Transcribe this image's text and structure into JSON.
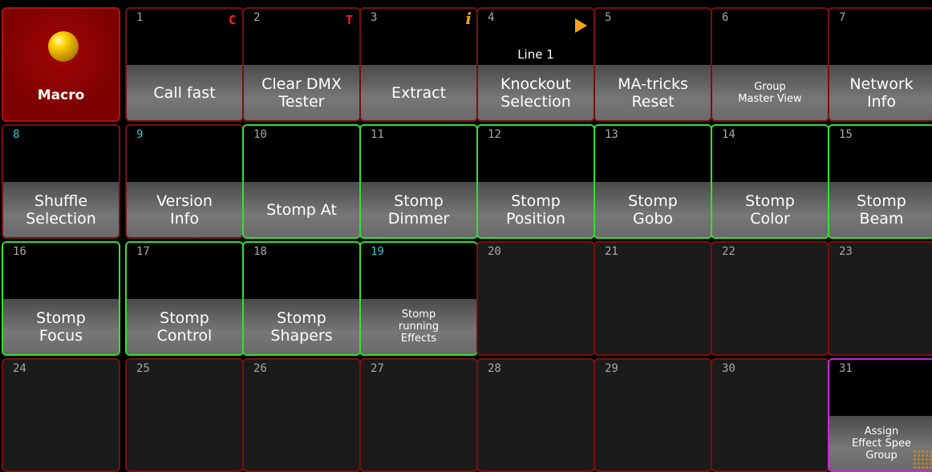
{
  "pool": {
    "title": "Macro",
    "title_icon": "yellow-sphere-icon"
  },
  "cells": [
    {
      "number": "1",
      "label": "Call fast",
      "indicator": "C"
    },
    {
      "number": "2",
      "label": "Clear DMX\nTester",
      "indicator": "T"
    },
    {
      "number": "3",
      "label": "Extract",
      "indicator_icon": "info-icon",
      "indicator_glyph": "i"
    },
    {
      "number": "4",
      "label": "Knockout\nSelection",
      "sub_text": "Line 1",
      "indicator_icon": "play-icon"
    },
    {
      "number": "5",
      "label": "MA-tricks\nReset"
    },
    {
      "number": "6",
      "label": "Group\nMaster View",
      "small": true
    },
    {
      "number": "7",
      "label": "Network\nInfo"
    },
    {
      "number": "8",
      "label": "Shuffle\nSelection",
      "number_color": "#2fc8d0"
    },
    {
      "number": "9",
      "label": "Version\nInfo",
      "number_color": "#2fc8d0"
    },
    {
      "number": "10",
      "label": "Stomp At",
      "border": "green"
    },
    {
      "number": "11",
      "label": "Stomp\nDimmer",
      "border": "green"
    },
    {
      "number": "12",
      "label": "Stomp\nPosition",
      "border": "green"
    },
    {
      "number": "13",
      "label": "Stomp\nGobo",
      "border": "green"
    },
    {
      "number": "14",
      "label": "Stomp\nColor",
      "border": "green"
    },
    {
      "number": "15",
      "label": "Stomp\nBeam",
      "border": "green"
    },
    {
      "number": "16",
      "label": "Stomp\nFocus",
      "border": "green"
    },
    {
      "number": "17",
      "label": "Stomp\nControl",
      "border": "green"
    },
    {
      "number": "18",
      "label": "Stomp\nShapers",
      "border": "green"
    },
    {
      "number": "19",
      "label": "Stomp\nrunning\nEffects",
      "border": "green",
      "small": true,
      "number_color": "#2fc8d0"
    },
    {
      "number": "20"
    },
    {
      "number": "21"
    },
    {
      "number": "22"
    },
    {
      "number": "23"
    },
    {
      "number": "24"
    },
    {
      "number": "25"
    },
    {
      "number": "26"
    },
    {
      "number": "27"
    },
    {
      "number": "28"
    },
    {
      "number": "29"
    },
    {
      "number": "30"
    },
    {
      "number": "31",
      "label": "Assign\nEffect Spee\nGroup",
      "border": "magenta",
      "small": true
    }
  ],
  "colors": {
    "border_default": "#7a0f0f",
    "border_green": "#2fe22f",
    "border_magenta": "#c52ad8",
    "number_cyan": "#2fc8d0",
    "indicator_red": "#ff1f1f",
    "indicator_orange": "#f5a21c"
  }
}
